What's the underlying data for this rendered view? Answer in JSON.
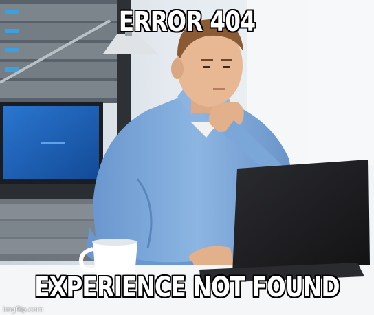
{
  "meme": {
    "top_text": "ERROR 404",
    "bottom_text": "EXPERIENCE NOT FOUND",
    "watermark": "imgflip.com"
  },
  "scene": {
    "subject": "man in blue shirt thinking at laptop",
    "colors": {
      "shirt": "#7aa6d8",
      "shirt_shadow": "#5b86bb",
      "skin": "#e8b894",
      "hair": "#8a5a34",
      "laptop": "#1f1f22",
      "monitor_screen": "#1c5fb4",
      "server_rack": "#6e757c",
      "desk": "#f4f6f7",
      "mug": "#ffffff"
    }
  }
}
